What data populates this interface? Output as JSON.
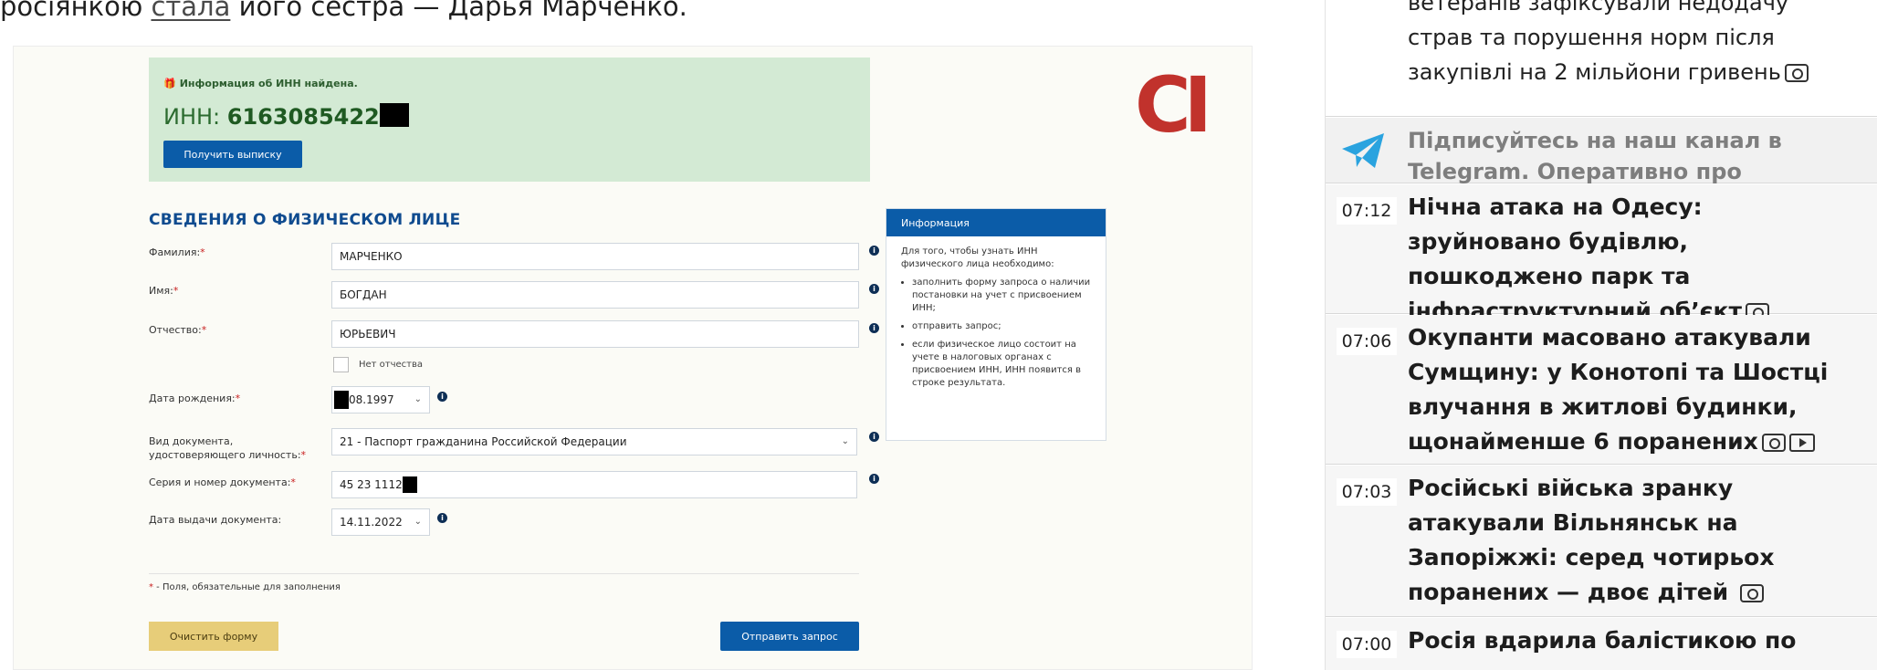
{
  "article": {
    "text_before": "росіянкою ",
    "link": "стала",
    "text_after": " його сестра — Дарья Марченко."
  },
  "form": {
    "inn_found_label": "Информация об ИНН найдена.",
    "inn_prefix": "ИНН: ",
    "inn_number": "6163085422",
    "extract_button": "Получить выписку",
    "logo_text": "CI",
    "section_title": "СВЕДЕНИЯ О ФИЗИЧЕСКОМ ЛИЦЕ",
    "fields": {
      "surname": {
        "label": "Фамилия:",
        "value": "МАРЧЕНКО"
      },
      "name": {
        "label": "Имя:",
        "value": "БОГДАН"
      },
      "patronymic": {
        "label": "Отчество:",
        "value": "ЮРЬЕВИЧ"
      },
      "no_patronymic": "Нет отчества",
      "birth_date": {
        "label": "Дата рождения:",
        "value": "08.1997"
      },
      "doc_type": {
        "label_1": "Вид документа,",
        "label_2": "удостоверяющего личность:",
        "value": "21 - Паспорт гражданина Российской Федерации"
      },
      "doc_number": {
        "label": "Серия и номер документа:",
        "value": "45 23 1112"
      },
      "issue_date": {
        "label": "Дата выдачи документа:",
        "value": "14.11.2022"
      }
    },
    "required_mark": "*",
    "footnote": " - Поля, обязательные для заполнения",
    "clear_button": "Очистить форму",
    "send_button": "Отправить запрос",
    "info": {
      "title": "Информация",
      "intro": "Для того, чтобы узнать ИНН физического лица необходимо:",
      "items": [
        "заполнить форму запроса о наличии постановки на учет с присвоением ИНН;",
        "отправить запрос;",
        "если физическое лицо состоит на учете в налоговых органах с присвоением ИНН, ИНН появится в строке результата."
      ]
    }
  },
  "sidebar": {
    "top_item": "ветеранів зафіксували недодачу страв та порушення норм після закупівлі на 2 мільйони гривень",
    "telegram": "Підписуйтесь на наш канал в Telegram. Оперативно про головне",
    "news": [
      {
        "time": "07:12",
        "title": "Нічна атака на Одесу: зруйновано будівлю, пошкоджено парк та інфраструктурний об’єкт"
      },
      {
        "time": "07:06",
        "title": "Окупанти масовано атакували Сумщину: у Конотопі та Шостці влучання в житлові будинки, щонайменше 6 поранених"
      },
      {
        "time": "07:03",
        "title": "Російські війська зранку атакували Вільнянськ на Запоріжжі: серед чотирьох поранених — двоє дітей"
      },
      {
        "time": "07:00",
        "title": "Росія вдарила балістикою по"
      }
    ]
  },
  "colors": {
    "form_blue": "#0b5ca8",
    "success_green": "#d3ead4",
    "clear_yellow": "#e7cd79",
    "logo_red": "#c1322c",
    "telegram_blue": "#2aa3df"
  }
}
